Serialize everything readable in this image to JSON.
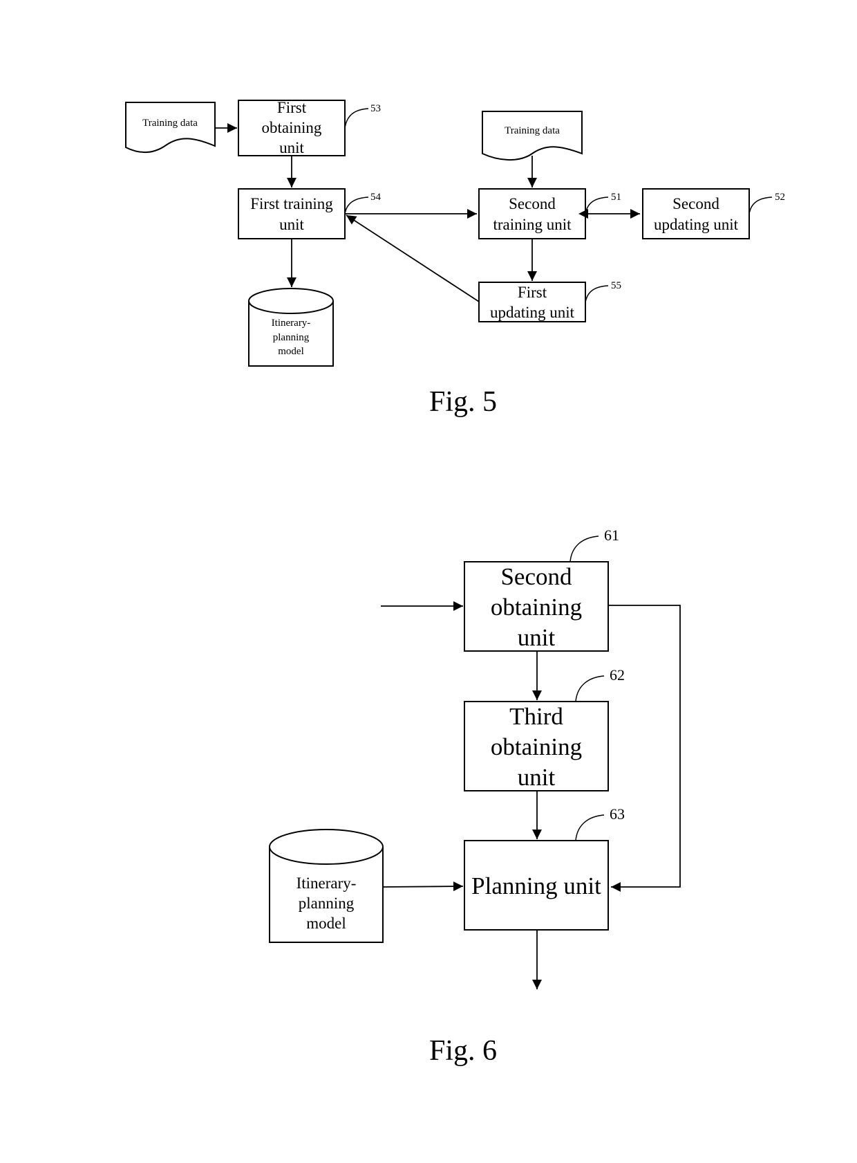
{
  "fig5": {
    "caption": "Fig. 5",
    "training_data_left": "Training data",
    "training_data_right": "Training data",
    "first_obtaining_unit": {
      "lines": [
        "First",
        "obtaining",
        "unit"
      ],
      "ref": "53"
    },
    "first_training_unit": {
      "lines": [
        "First training",
        "unit"
      ],
      "ref": "54"
    },
    "second_training_unit": {
      "lines": [
        "Second",
        "training unit"
      ],
      "ref": "51"
    },
    "second_updating_unit": {
      "lines": [
        "Second",
        "updating unit"
      ],
      "ref": "52"
    },
    "first_updating_unit": {
      "lines": [
        "First",
        "updating unit"
      ],
      "ref": "55"
    },
    "model": {
      "lines": [
        "Itinerary-",
        "planning",
        "model"
      ]
    }
  },
  "fig6": {
    "caption": "Fig. 6",
    "second_obtaining_unit": {
      "lines": [
        "Second",
        "obtaining",
        "unit"
      ],
      "ref": "61"
    },
    "third_obtaining_unit": {
      "lines": [
        "Third",
        "obtaining",
        "unit"
      ],
      "ref": "62"
    },
    "planning_unit": {
      "lines": [
        "Planning unit"
      ],
      "ref": "63"
    },
    "model": {
      "lines": [
        "Itinerary-",
        "planning",
        "model"
      ]
    }
  }
}
